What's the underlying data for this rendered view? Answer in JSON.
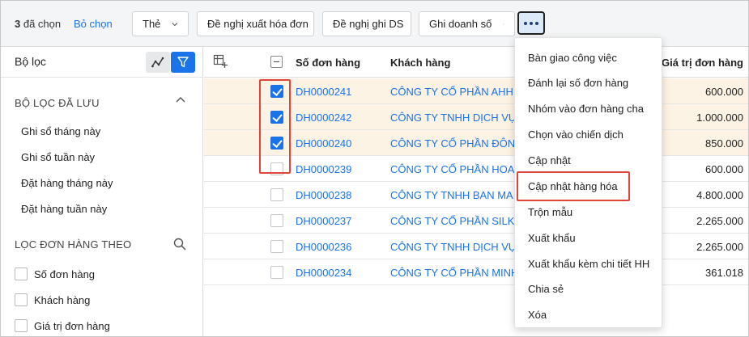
{
  "toolbar": {
    "selected_count": "3",
    "selected_suffix": "đã chọn",
    "deselect_label": "Bỏ chọn",
    "tag_label": "Thẻ",
    "request_invoice_label": "Đề nghị xuất hóa đơn",
    "request_sales_label": "Đề nghị ghi DS",
    "record_sales_label": "Ghi doanh số"
  },
  "sidebar": {
    "title": "Bộ lọc",
    "saved_filters_title": "BỘ LỌC ĐÃ LƯU",
    "saved_filters": [
      "Ghi sổ tháng này",
      "Ghi sổ tuần này",
      "Đặt hàng tháng này",
      "Đặt hàng tuần này"
    ],
    "filter_by_title": "LỌC ĐƠN HÀNG THEO",
    "filter_fields": [
      "Số đơn hàng",
      "Khách hàng",
      "Giá trị đơn hàng"
    ]
  },
  "table": {
    "headers": {
      "order_no": "Số đơn hàng",
      "customer": "Khách hàng",
      "value": "Giá trị đơn hàng"
    },
    "rows": [
      {
        "order": "DH0000241",
        "customer": "CÔNG TY CỔ PHẦN AHH TUẤN",
        "value": "600.000",
        "checked": true
      },
      {
        "order": "DH0000242",
        "customer": "CÔNG TY TNHH DỊCH VỤ HOÀNG",
        "value": "1.000.000",
        "checked": true
      },
      {
        "order": "DH0000240",
        "customer": "CÔNG TY CỔ PHẦN ĐÔNG",
        "value": "850.000",
        "checked": true
      },
      {
        "order": "DH0000239",
        "customer": "CÔNG TY CỔ PHẦN HOA SEN",
        "value": "600.000",
        "checked": false
      },
      {
        "order": "DH0000238",
        "customer": "CÔNG TY TNHH BAN MAI XANH",
        "value": "4.800.000",
        "checked": false
      },
      {
        "order": "DH0000237",
        "customer": "CÔNG TY CỔ PHẦN SILK MAY",
        "value": "2.265.000",
        "checked": false
      },
      {
        "order": "DH0000236",
        "customer": "CÔNG TY TNHH DỊCH VỤ HOÀNG",
        "value": "2.265.000",
        "checked": false
      },
      {
        "order": "DH0000234",
        "customer": "CÔNG TY CỔ PHẦN MINH",
        "value": "361.018",
        "checked": false
      }
    ]
  },
  "menu": {
    "items": [
      "Bàn giao công việc",
      "Đánh lại số đơn hàng",
      "Nhóm vào đơn hàng cha",
      "Chọn vào chiến dịch",
      "Cập nhật",
      "Cập nhật hàng hóa",
      "Trộn mẫu",
      "Xuất khẩu",
      "Xuất khẩu kèm chi tiết HH",
      "Chia sẻ",
      "Xóa"
    ],
    "highlighted_index": 5
  },
  "colors": {
    "accent": "#1a73e8",
    "selected_row": "#fdf3e4",
    "highlight_border": "#e0453c"
  }
}
